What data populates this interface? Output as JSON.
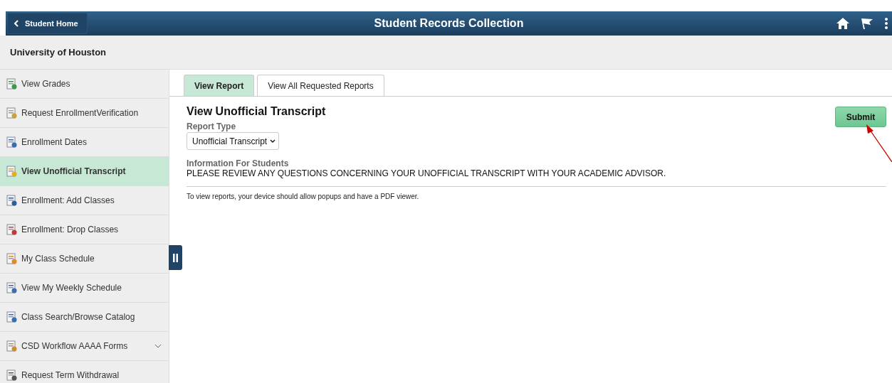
{
  "header": {
    "back_button": "Student Home",
    "title": "Student Records Collection"
  },
  "subheader": {
    "title": "University of Houston"
  },
  "sidebar": {
    "items": [
      {
        "label": "View Grades",
        "selected": false
      },
      {
        "label": "Request EnrollmentVerification",
        "selected": false
      },
      {
        "label": "Enrollment Dates",
        "selected": false
      },
      {
        "label": "View Unofficial Transcript",
        "selected": true
      },
      {
        "label": "Enrollment: Add Classes",
        "selected": false
      },
      {
        "label": "Enrollment:  Drop Classes",
        "selected": false
      },
      {
        "label": "My Class Schedule",
        "selected": false
      },
      {
        "label": "View My Weekly Schedule",
        "selected": false
      },
      {
        "label": "Class Search/Browse Catalog",
        "selected": false
      },
      {
        "label": "CSD Workflow AAAA Forms",
        "selected": false,
        "expanded": false
      },
      {
        "label": "Request Term Withdrawal",
        "selected": false
      }
    ]
  },
  "tabs": [
    {
      "label": "View Report",
      "selected": true
    },
    {
      "label": "View All Requested Reports",
      "selected": false
    }
  ],
  "content": {
    "title": "View Unofficial Transcript",
    "submit": "Submit",
    "report_type": {
      "label": "Report Type",
      "value": "Unofficial Transcript"
    },
    "info": {
      "label": "Information For Students",
      "text": "PLEASE REVIEW ANY QUESTIONS CONCERNING YOUR UNOFFICIAL TRANSCRIPT WITH YOUR ACADEMIC ADVISOR."
    },
    "note": "To view reports, your device should allow popups and have a PDF viewer."
  }
}
